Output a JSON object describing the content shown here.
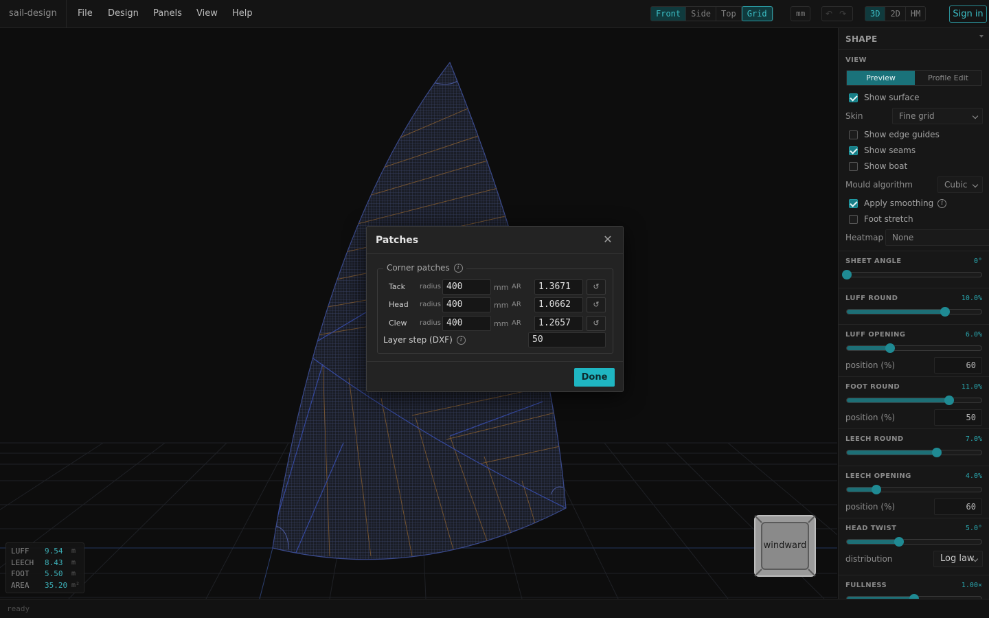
{
  "app": {
    "brand": "sail-design"
  },
  "menu": [
    "File",
    "Design",
    "Panels",
    "View",
    "Help"
  ],
  "toolbar": {
    "views": [
      "Front",
      "Side",
      "Top"
    ],
    "grid_label": "Grid",
    "units_label": "mm",
    "undo_icon": "undo-icon",
    "redo_icon": "redo-icon",
    "modes": [
      "3D",
      "2D",
      "HM"
    ],
    "active_view": "Front",
    "active_mode": "3D",
    "sign_in": "Sign in"
  },
  "stats": [
    {
      "key": "LUFF",
      "value": "9.54",
      "unit": "m"
    },
    {
      "key": "LEECH",
      "value": "8.43",
      "unit": "m"
    },
    {
      "key": "FOOT",
      "value": "5.50",
      "unit": "m"
    },
    {
      "key": "AREA",
      "value": "35.20",
      "unit": "m²"
    }
  ],
  "status": "ready",
  "compass": {
    "label": "windward"
  },
  "panel": {
    "title": "SHAPE",
    "view_section": "VIEW",
    "tabs": [
      "Preview",
      "Profile Edit"
    ],
    "active_tab": "Preview",
    "show_surface": {
      "label": "Show surface",
      "checked": true
    },
    "skin": {
      "label": "Skin",
      "value": "Fine grid"
    },
    "show_edge_guides": {
      "label": "Show edge guides",
      "checked": false
    },
    "show_seams": {
      "label": "Show seams",
      "checked": true
    },
    "show_boat": {
      "label": "Show boat",
      "checked": false
    },
    "mould": {
      "label": "Mould algorithm",
      "value": "Cubic"
    },
    "apply_smoothing": {
      "label": "Apply smoothing",
      "checked": true
    },
    "foot_stretch": {
      "label": "Foot stretch",
      "checked": false
    },
    "heatmap": {
      "label": "Heatmap",
      "value": "None"
    },
    "sliders": [
      {
        "name": "SHEET ANGLE",
        "value": "0°",
        "fraction": 0.0
      },
      {
        "name": "LUFF ROUND",
        "value": "10.0%",
        "fraction": 0.73
      },
      {
        "name": "LUFF OPENING",
        "value": "6.0%",
        "fraction": 0.32,
        "position_label": "position (%)",
        "position": "60"
      },
      {
        "name": "FOOT ROUND",
        "value": "11.0%",
        "fraction": 0.76,
        "position_label": "position (%)",
        "position": "50"
      },
      {
        "name": "LEECH ROUND",
        "value": "7.0%",
        "fraction": 0.67
      },
      {
        "name": "LEECH OPENING",
        "value": "4.0%",
        "fraction": 0.22,
        "position_label": "position (%)",
        "position": "60"
      },
      {
        "name": "HEAD TWIST",
        "value": "5.0°",
        "fraction": 0.39,
        "distribution_label": "distribution",
        "distribution": "Log law"
      },
      {
        "name": "FULLNESS",
        "value": "1.00×",
        "fraction": 0.5
      }
    ]
  },
  "modal": {
    "title": "Patches",
    "group_label": "Corner patches",
    "radius_label": "radius",
    "unit": "mm",
    "ar_label": "AR",
    "corners": [
      {
        "name": "Tack",
        "radius": "400",
        "ar": "1.3671"
      },
      {
        "name": "Head",
        "radius": "400",
        "ar": "1.0662"
      },
      {
        "name": "Clew",
        "radius": "400",
        "ar": "1.2657"
      }
    ],
    "layer_step_label": "Layer step (DXF)",
    "layer_step": "50",
    "done": "Done"
  },
  "colors": {
    "accent": "#1fb6c2",
    "mesh": "#3a4a8c",
    "seam": "#b07a3a"
  }
}
